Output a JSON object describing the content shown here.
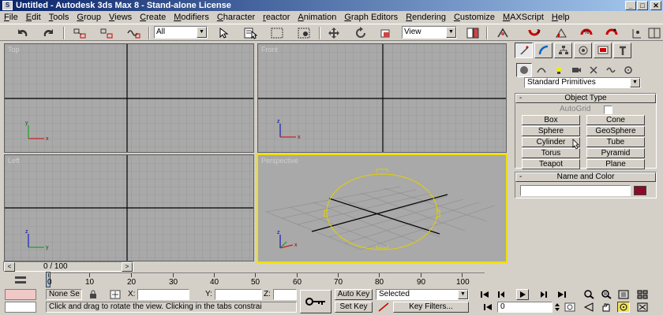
{
  "window": {
    "title": "Untitled - Autodesk 3ds Max 8 - Stand-alone License",
    "app_icon": "3ds-max-icon",
    "min": "_",
    "max": "□",
    "close": "✕"
  },
  "menu": [
    "File",
    "Edit",
    "Tools",
    "Group",
    "Views",
    "Create",
    "Modifiers",
    "Character",
    "reactor",
    "Animation",
    "Graph Editors",
    "Rendering",
    "Customize",
    "MAXScript",
    "Help"
  ],
  "toolbar": {
    "selection_filter": "All",
    "reference_coord": "View"
  },
  "viewports": {
    "top": "Top",
    "front": "Front",
    "left": "Left",
    "perspective": "Perspective"
  },
  "command_panel": {
    "category": "Standard Primitives",
    "object_type": {
      "title": "Object Type",
      "autogrid": "AutoGrid",
      "buttons": [
        "Box",
        "Cone",
        "Sphere",
        "GeoSphere",
        "Cylinder",
        "Tube",
        "Torus",
        "Pyramid",
        "Teapot",
        "Plane"
      ]
    },
    "name_color": {
      "title": "Name and Color",
      "name_value": "",
      "color": "#8b0a2a"
    },
    "minus": "-"
  },
  "time_slider": {
    "label": "0 / 100",
    "left": "<",
    "right": ">"
  },
  "trackbar": {
    "ticks": [
      "0",
      "10",
      "20",
      "30",
      "40",
      "50",
      "60",
      "70",
      "80",
      "90",
      "100"
    ]
  },
  "status": {
    "selection": "None Se",
    "x_label": "X:",
    "y_label": "Y:",
    "z_label": "Z:",
    "prompt": "Click and drag to rotate the view.  Clicking in the tabs constrai",
    "auto_key": "Auto Key",
    "set_key": "Set Key",
    "key_mode": "Selected",
    "key_filters": "Key Filters...",
    "frame": "0"
  },
  "colors": {
    "viewport_bg": "#a9a9a9",
    "active_border": "#f0e000",
    "selected_object": "#e0d000"
  }
}
